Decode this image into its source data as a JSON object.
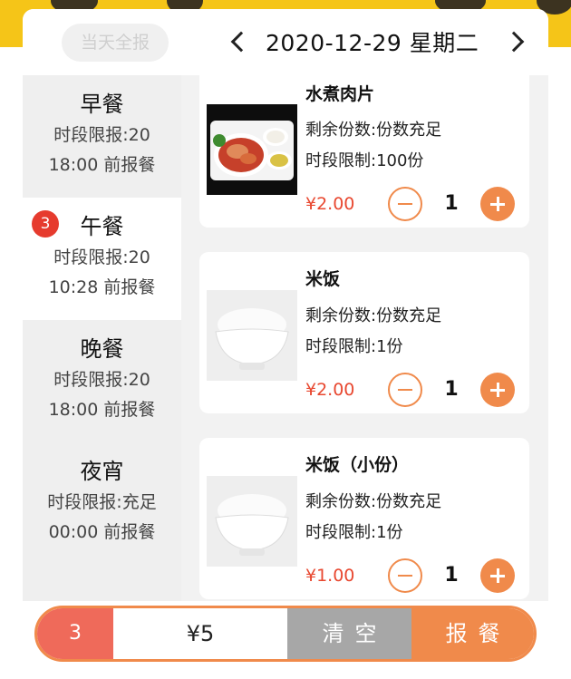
{
  "header": {
    "allday_label": "当天全报",
    "date": "2020-12-29 星期二"
  },
  "sidebar": {
    "meals": [
      {
        "name": "早餐",
        "limit": "时段限报:20",
        "deadline": "18:00 前报餐",
        "badge": null
      },
      {
        "name": "午餐",
        "limit": "时段限报:20",
        "deadline": "10:28 前报餐",
        "badge": "3"
      },
      {
        "name": "晚餐",
        "limit": "时段限报:20",
        "deadline": "18:00 前报餐",
        "badge": null
      },
      {
        "name": "夜宵",
        "limit": "时段限报:充足",
        "deadline": "00:00 前报餐",
        "badge": null
      }
    ]
  },
  "dishes": [
    {
      "name": "水煮肉片",
      "remaining": "剩余份数:份数充足",
      "limit": "时段限制:100份",
      "price": "¥2.00",
      "qty": "1"
    },
    {
      "name": "米饭",
      "remaining": "剩余份数:份数充足",
      "limit": "时段限制:1份",
      "price": "¥2.00",
      "qty": "1"
    },
    {
      "name": "米饭（小份）",
      "remaining": "剩余份数:份数充足",
      "limit": "时段限制:1份",
      "price": "¥1.00",
      "qty": "1"
    }
  ],
  "footer": {
    "count": "3",
    "total": "¥5",
    "clear_label": "清空",
    "submit_label": "报餐"
  },
  "colors": {
    "accent": "#f08a4b",
    "price": "#e8472f",
    "badge": "#e63b2e",
    "top_bg": "#f5c518"
  }
}
